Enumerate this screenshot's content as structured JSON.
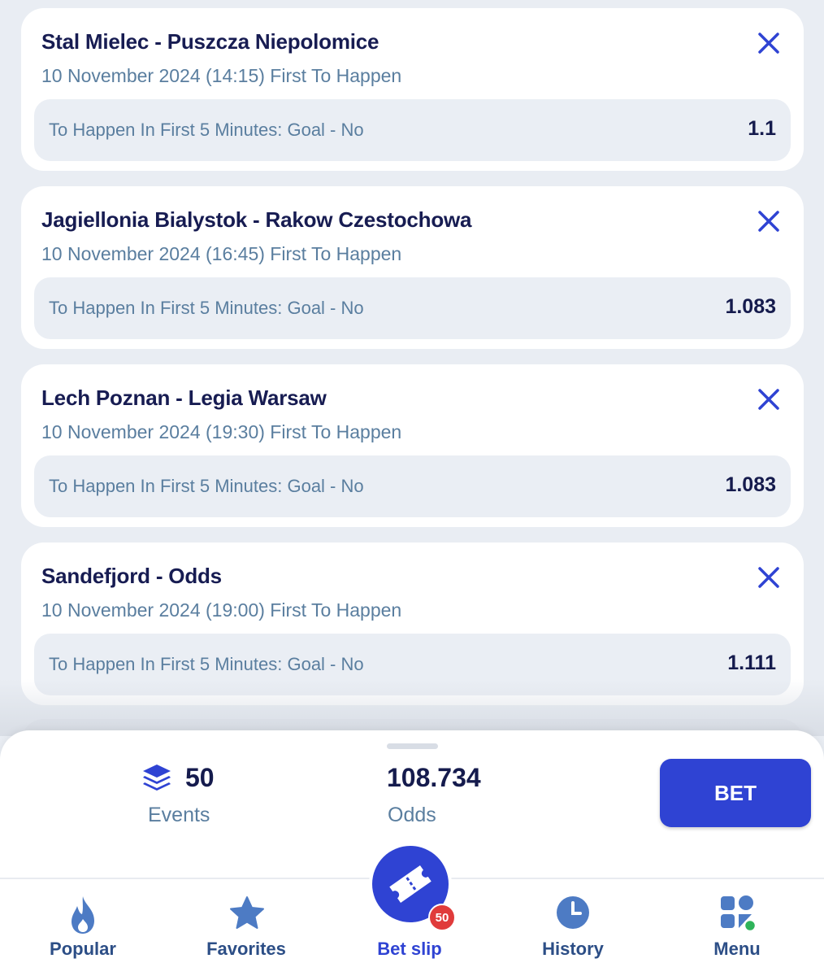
{
  "bets": [
    {
      "match": "Stal Mielec - Puszcza Niepolomice",
      "subtitle": "10 November 2024 (14:15) First To Happen",
      "selection": "To Happen In First 5 Minutes: Goal - No",
      "odds": "1.1"
    },
    {
      "match": "Jagiellonia Bialystok - Rakow Czestochowa",
      "subtitle": "10 November 2024 (16:45) First To Happen",
      "selection": "To Happen In First 5 Minutes: Goal - No",
      "odds": "1.083"
    },
    {
      "match": "Lech Poznan - Legia Warsaw",
      "subtitle": "10 November 2024 (19:30) First To Happen",
      "selection": "To Happen In First 5 Minutes: Goal - No",
      "odds": "1.083"
    },
    {
      "match": "Sandefjord - Odds",
      "subtitle": "10 November 2024 (19:00) First To Happen",
      "selection": "To Happen In First 5 Minutes: Goal - No",
      "odds": "1.111"
    }
  ],
  "summary": {
    "events_count": "50",
    "events_label": "Events",
    "total_odds": "108.734",
    "odds_label": "Odds",
    "bet_label": "BET",
    "events_icon": "layers-icon"
  },
  "nav": {
    "popular": "Popular",
    "favorites": "Favorites",
    "betslip": "Bet slip",
    "betslip_badge": "50",
    "history": "History",
    "menu": "Menu"
  },
  "colors": {
    "accent": "#2f43d3",
    "title": "#171c52",
    "muted": "#5a7e9f",
    "nav": "#2c4e86",
    "badge": "#e03b3b",
    "online_dot": "#2fb35a"
  }
}
